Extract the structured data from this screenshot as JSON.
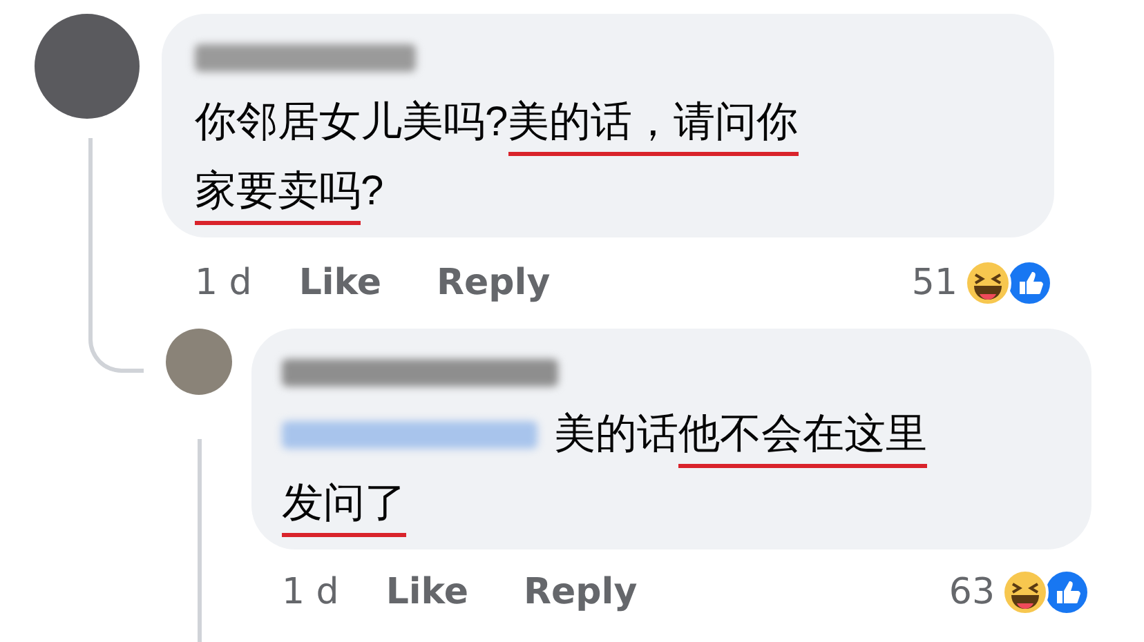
{
  "comment": {
    "lines": [
      [
        {
          "text": "你邻居女儿美吗? ",
          "underlined": false
        },
        {
          "text": "美的话，请问你",
          "underlined": true
        }
      ],
      [
        {
          "text": "家要卖吗",
          "underlined": true
        },
        {
          "text": "?",
          "underlined": false
        }
      ]
    ],
    "time": "1 d",
    "actions": [
      "Like",
      "Reply"
    ],
    "reaction_count": "51"
  },
  "reply": {
    "lines": [
      [
        {
          "text": "美的话",
          "underlined": false
        },
        {
          "text": "他不会在这里",
          "underlined": true
        }
      ],
      [
        {
          "text": "发问了",
          "underlined": true
        }
      ]
    ],
    "time": "1 d",
    "actions": [
      "Like",
      "Reply"
    ],
    "reaction_count": "63"
  }
}
